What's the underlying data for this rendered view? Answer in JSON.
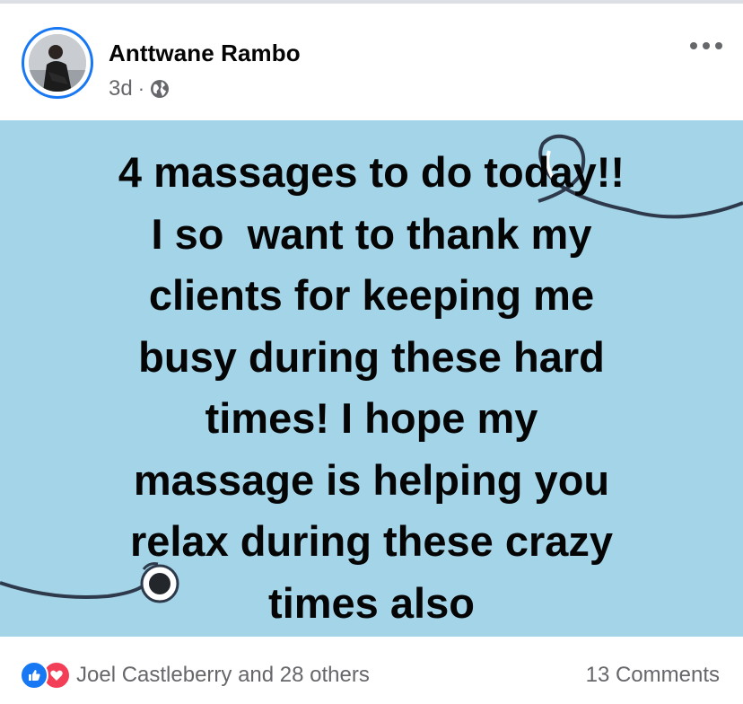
{
  "post": {
    "author": {
      "name": "Anttwane Rambo",
      "avatar_icon": "profile-photo"
    },
    "meta": {
      "time": "3d",
      "separator": "·",
      "privacy_icon": "globe-icon"
    },
    "more_icon": "more-horizontal-icon",
    "background_color": "#a3d4e7",
    "text_lines": [
      "4 massages to do today!!",
      "I so  want to thank my",
      "clients for keeping me",
      "busy during these hard",
      "times! I hope my",
      "massage is helping you",
      "relax during these crazy",
      "times also"
    ]
  },
  "footer": {
    "reaction_icons": [
      "like-icon",
      "love-icon"
    ],
    "reactors": "Joel Castleberry and 28 others",
    "comments": "13 Comments"
  },
  "colors": {
    "accent": "#1877f2",
    "like": "#1877f2",
    "love": "#f33e58",
    "secondary_text": "#65676b",
    "primary_text": "#050505"
  }
}
